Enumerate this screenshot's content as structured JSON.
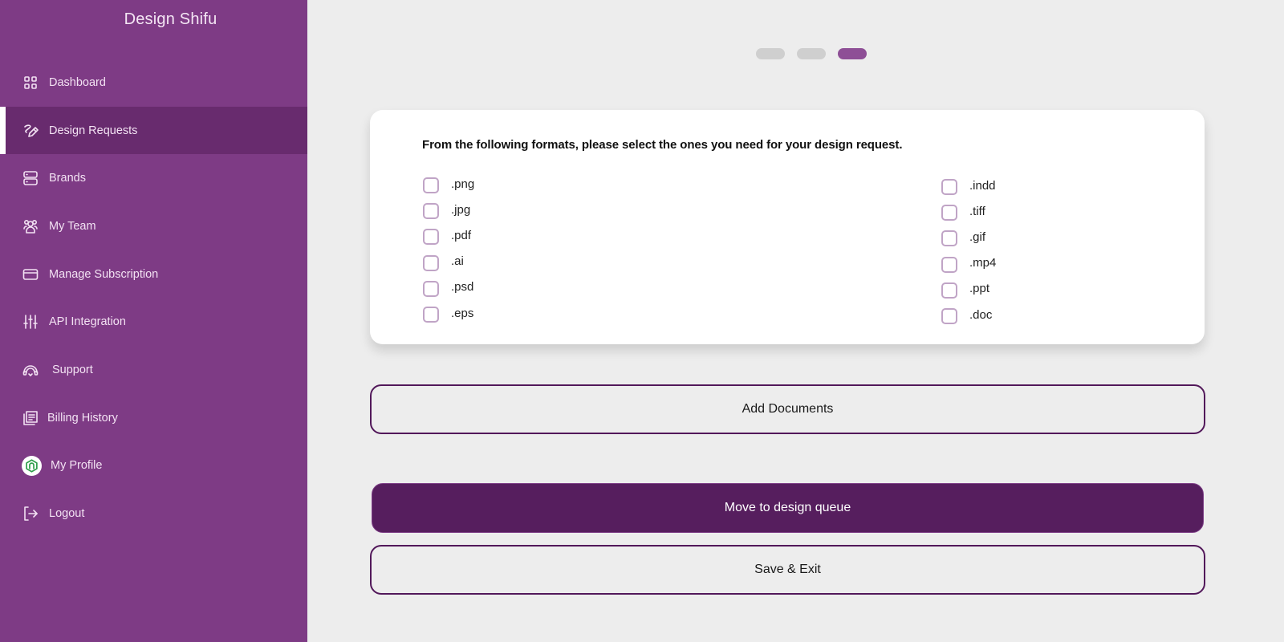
{
  "sidebar": {
    "brand": "Design Shifu",
    "items": [
      {
        "label": "Dashboard",
        "icon": "grid-icon",
        "active": false
      },
      {
        "label": "Design Requests",
        "icon": "pen-request-icon",
        "active": true
      },
      {
        "label": "Brands",
        "icon": "server-icon",
        "active": false
      },
      {
        "label": "My Team",
        "icon": "team-icon",
        "active": false
      },
      {
        "label": "Manage Subscription",
        "icon": "credit-card-icon",
        "active": false
      },
      {
        "label": "API Integration",
        "icon": "sliders-icon",
        "active": false
      },
      {
        "label": "Support",
        "icon": "headset-icon",
        "active": false
      },
      {
        "label": "Billing History",
        "icon": "billing-docs-icon",
        "active": false
      },
      {
        "label": "My Profile",
        "icon": "profile-avatar-icon",
        "active": false
      },
      {
        "label": "Logout",
        "icon": "logout-icon",
        "active": false
      }
    ]
  },
  "progress": {
    "total_steps": 3,
    "current_step": 3
  },
  "form": {
    "question": "From the following formats, please select the ones you need for your design request.",
    "formats_left": [
      {
        "label": ".png",
        "checked": false
      },
      {
        "label": ".jpg",
        "checked": false
      },
      {
        "label": ".pdf",
        "checked": false
      },
      {
        "label": ".ai",
        "checked": false
      },
      {
        "label": ".psd",
        "checked": false
      },
      {
        "label": ".eps",
        "checked": false
      }
    ],
    "formats_right": [
      {
        "label": ".indd",
        "checked": false
      },
      {
        "label": ".tiff",
        "checked": false
      },
      {
        "label": ".gif",
        "checked": false
      },
      {
        "label": ".mp4",
        "checked": false
      },
      {
        "label": ".ppt",
        "checked": false
      },
      {
        "label": ".doc",
        "checked": false
      }
    ]
  },
  "actions": {
    "add_documents": "Add Documents",
    "move_to_queue": "Move to design queue",
    "save_exit": "Save & Exit"
  },
  "colors": {
    "sidebar_bg": "#7e3b85",
    "sidebar_active": "#682b6e",
    "primary": "#561e5e",
    "step_active": "#8e4f96",
    "step_inactive": "#cfcfcf",
    "checkbox_border": "#c0a4c6"
  }
}
